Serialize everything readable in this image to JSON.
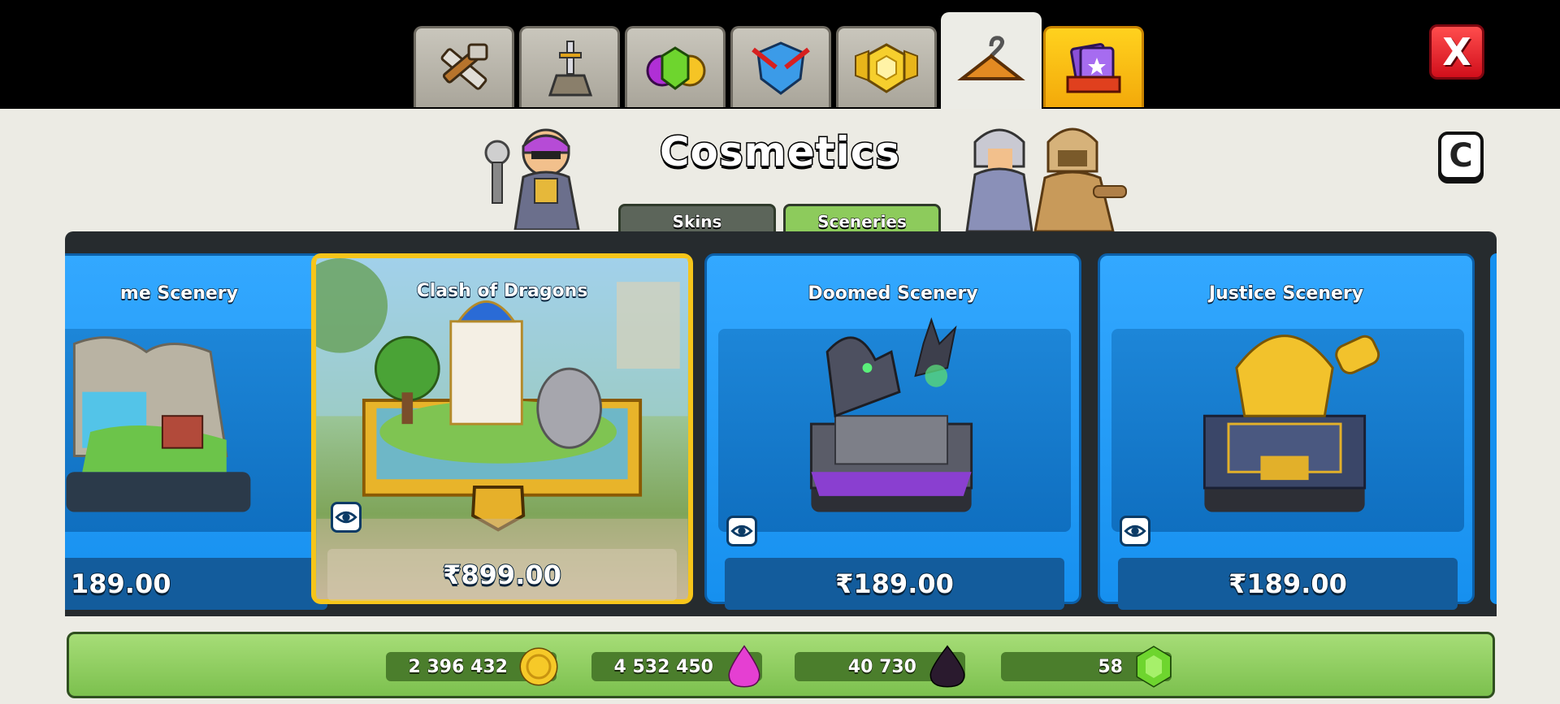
{
  "top_tabs": [
    {
      "id": "builder",
      "icon": "hammer-saw-icon"
    },
    {
      "id": "defense",
      "icon": "sword-pedestal-icon"
    },
    {
      "id": "resources",
      "icon": "gem-coin-icon"
    },
    {
      "id": "army",
      "icon": "shield-arrows-icon"
    },
    {
      "id": "gold-pass",
      "icon": "gold-hexagon-badge-icon"
    },
    {
      "id": "cosmetics",
      "icon": "hanger-icon",
      "active": true
    },
    {
      "id": "special",
      "icon": "card-pack-icon"
    }
  ],
  "close_label": "X",
  "header": {
    "title": "Cosmetics",
    "creator_code_label": "C"
  },
  "subtabs": {
    "skins": "Skins",
    "sceneries": "Sceneries"
  },
  "cards": [
    {
      "name": "me Scenery",
      "price": "189.00"
    },
    {
      "name": "Clash of Dragons",
      "price": "₹899.00"
    },
    {
      "name": "Doomed Scenery",
      "price": "₹189.00"
    },
    {
      "name": "Justice Scenery",
      "price": "₹189.00"
    }
  ],
  "resources": {
    "gold": "2 396 432",
    "elixir": "4 532 450",
    "dark_elixir": "40 730",
    "gems": "58"
  },
  "colors": {
    "card_blue": "#1690ef",
    "featured_border": "#f6c51a",
    "resource_bar": "#8ccd5e",
    "close_red": "#e0161f"
  }
}
